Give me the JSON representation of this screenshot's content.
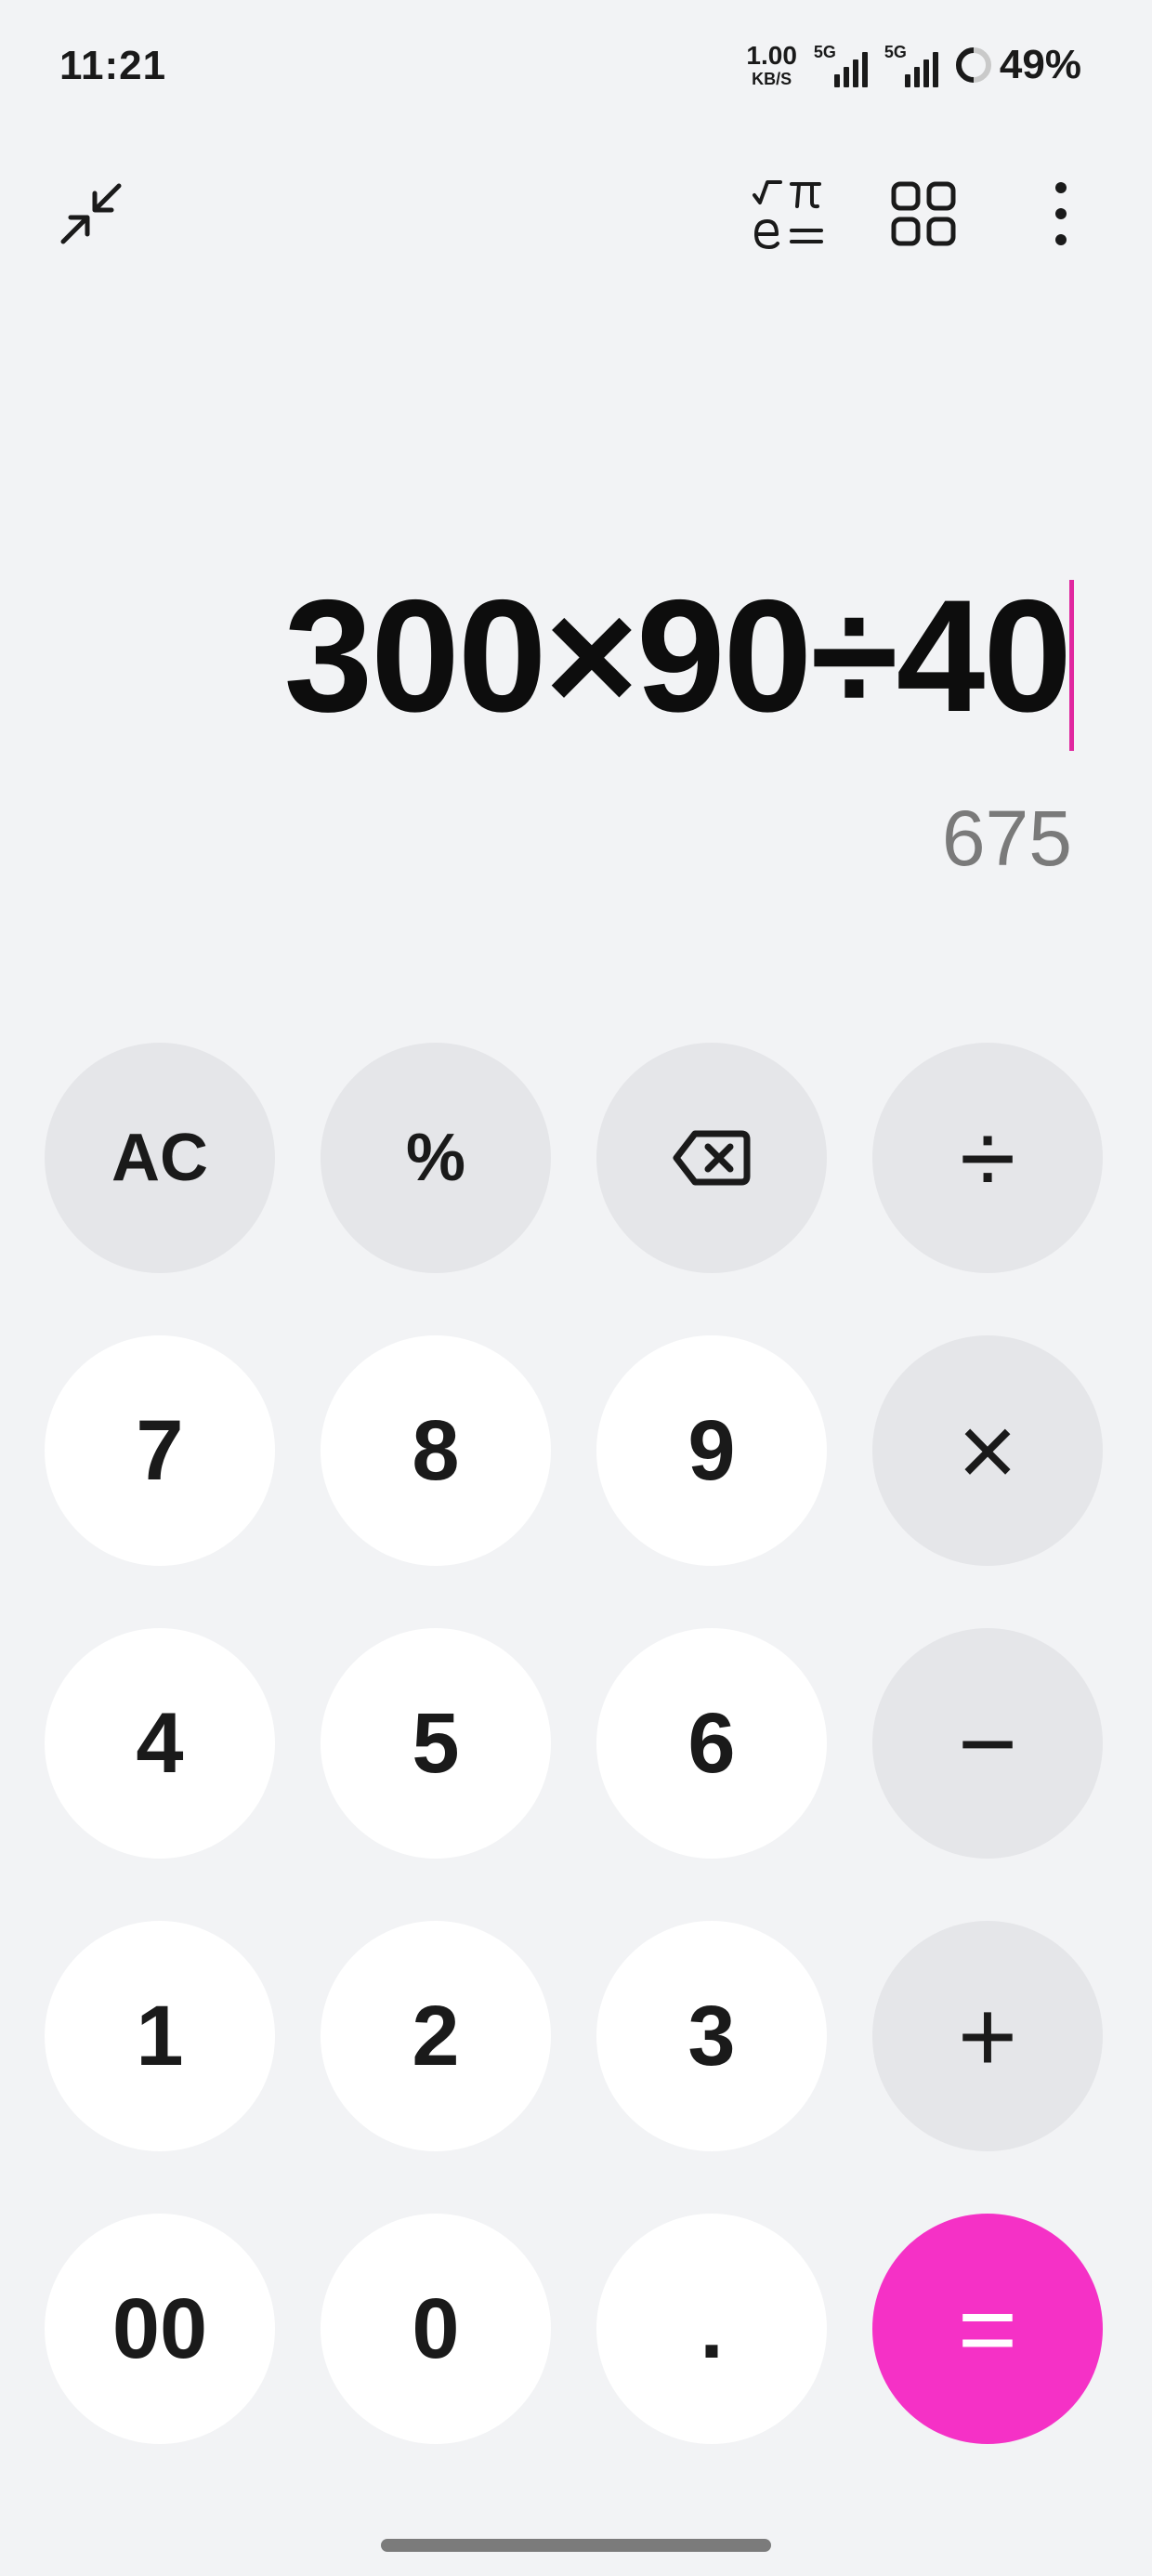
{
  "status_bar": {
    "time": "11:21",
    "net_speed_value": "1.00",
    "net_speed_unit": "KB/S",
    "sim1_label": "5G",
    "sim2_label": "5G",
    "battery_percent": "49%"
  },
  "toolbar": {
    "collapse_icon": "collapse-arrows-icon",
    "scientific_icon": "scientific-mode-icon",
    "converter_icon": "grid-apps-icon",
    "more_icon": "more-vertical-icon"
  },
  "display": {
    "expression": "300×90÷40",
    "result": "675"
  },
  "keypad": {
    "ac": "AC",
    "percent": "%",
    "backspace_icon": "backspace-icon",
    "divide": "÷",
    "seven": "7",
    "eight": "8",
    "nine": "9",
    "multiply": "×",
    "four": "4",
    "five": "5",
    "six": "6",
    "minus": "−",
    "one": "1",
    "two": "2",
    "three": "3",
    "plus": "+",
    "double_zero": "00",
    "zero": "0",
    "decimal": ".",
    "equals": "="
  },
  "colors": {
    "background": "#f2f3f5",
    "accent": "#f531c6",
    "operator_key": "#e5e6e9",
    "digit_key": "#ffffff",
    "caret": "#e0279f",
    "result_text": "#7a7a7a"
  }
}
